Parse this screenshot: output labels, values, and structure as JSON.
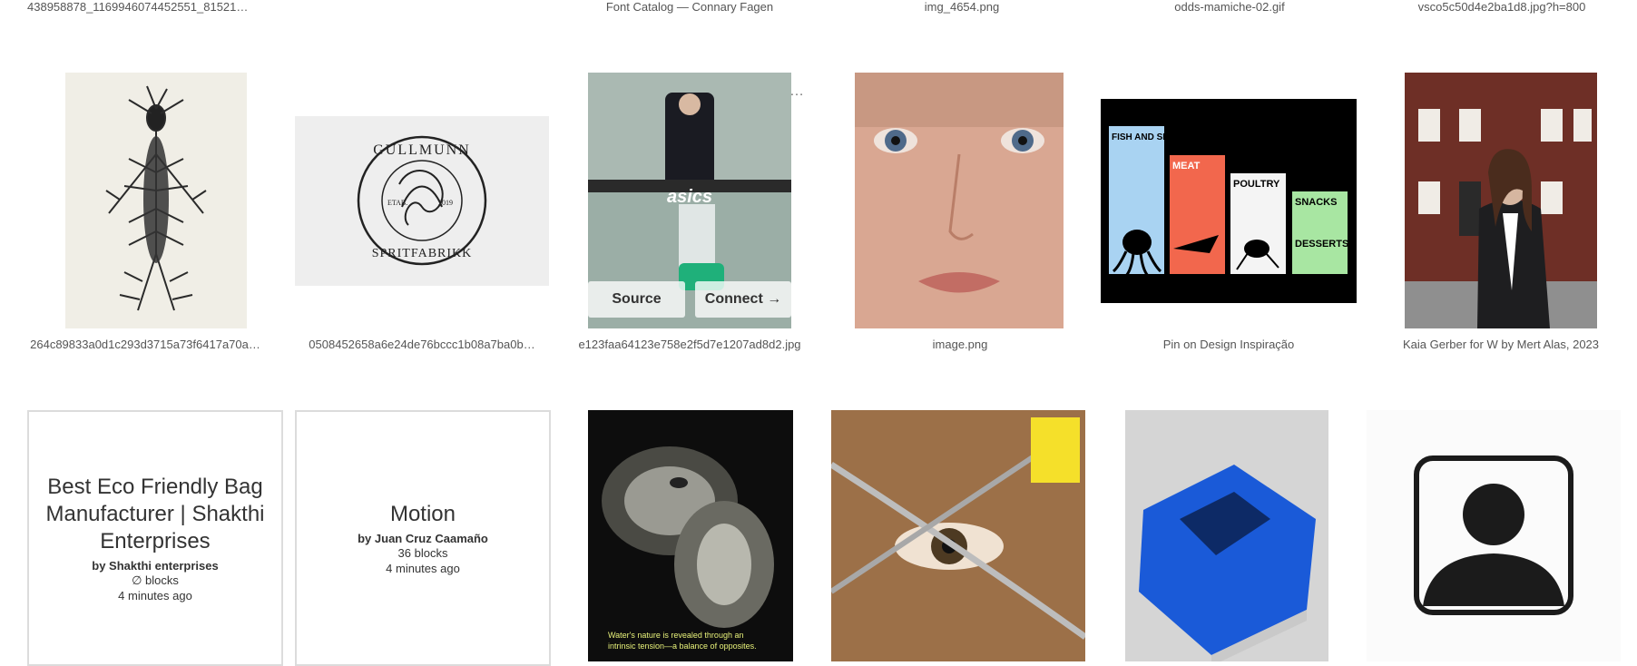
{
  "top_captions": [
    "438958878_1169946074452551_8152191…",
    "Font Catalog — Connary Fagen",
    "img_4654.png",
    "odds-mamiche-02.gif",
    "vsco5c50d4e2ba1d8.jpg?h=800"
  ],
  "row2": {
    "items": [
      {
        "caption": "264c89833a0d1c293d3715a73f6417a70a…"
      },
      {
        "caption": "0508452658a6e24de76bccc1b08a7ba0b…",
        "logo": {
          "top": "GULLMUNN",
          "bottom": "SPRITFABRIKK",
          "left": "ETAB.",
          "right": "2019"
        }
      },
      {
        "caption": "e123faa64123e758e2f5d7e1207ad8d2.jpg",
        "brand": "asics",
        "more": "…",
        "source_label": "Source",
        "connect_label": "Connect →"
      },
      {
        "caption": "image.png"
      },
      {
        "caption": "Pin on Design Inspiração",
        "menu": {
          "fish": "FISH AND SEAFOODS",
          "meat": "MEAT",
          "poultry": "POULTRY",
          "snacks": "SNACKS",
          "desserts": "DESSERTS"
        }
      },
      {
        "caption": "Kaia Gerber for W by Mert Alas, 2023"
      }
    ]
  },
  "row3": {
    "channel1": {
      "title": "Best Eco Friendly Bag Manufacturer | Shakthi Enterprises",
      "by": "by Shakthi enterprises",
      "blocks": "∅ blocks",
      "time": "4 minutes ago"
    },
    "channel2": {
      "title": "Motion",
      "by": "by Juan Cruz Caamaño",
      "blocks": "36 blocks",
      "time": "4 minutes ago"
    },
    "water_text": "Water's nature is revealed through an intrinsic tension—a balance of opposites."
  }
}
